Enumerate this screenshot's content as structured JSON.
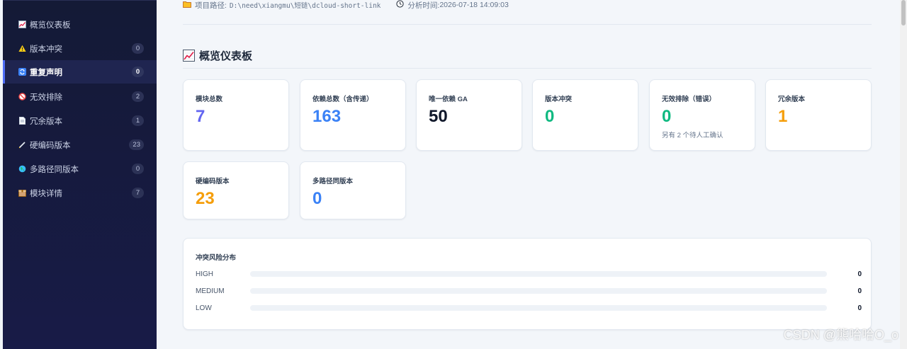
{
  "sidebar": {
    "items": [
      {
        "label": "概览仪表板",
        "badge": "",
        "icon": "chart-icon"
      },
      {
        "label": "版本冲突",
        "badge": "0",
        "icon": "warning-icon"
      },
      {
        "label": "重复声明",
        "badge": "0",
        "icon": "repeat-icon"
      },
      {
        "label": "无效排除",
        "badge": "2",
        "icon": "prohibited-icon"
      },
      {
        "label": "冗余版本",
        "badge": "1",
        "icon": "document-icon"
      },
      {
        "label": "硬编码版本",
        "badge": "23",
        "icon": "pencil-icon"
      },
      {
        "label": "多路径同版本",
        "badge": "0",
        "icon": "globe-icon"
      },
      {
        "label": "模块详情",
        "badge": "7",
        "icon": "package-icon"
      }
    ],
    "active_index": 2
  },
  "meta": {
    "path_label": "项目路径:",
    "path_value": "D:\\need\\xiangmu\\短链\\dcloud-short-link",
    "time_label": "分析时间:",
    "time_value": "2026-07-18 14:09:03"
  },
  "section": {
    "title": "概览仪表板"
  },
  "stats": [
    {
      "label": "模块总数",
      "value": "7",
      "color": "#6366f1",
      "sub": ""
    },
    {
      "label": "依赖总数（含传递）",
      "value": "163",
      "color": "#3b82f6",
      "sub": ""
    },
    {
      "label": "唯一依赖 GA",
      "value": "50",
      "color": "#0f172a",
      "sub": ""
    },
    {
      "label": "版本冲突",
      "value": "0",
      "color": "#10b981",
      "sub": ""
    },
    {
      "label": "无效排除（错误）",
      "value": "0",
      "color": "#10b981",
      "sub": "另有 2 个待人工确认"
    },
    {
      "label": "冗余版本",
      "value": "1",
      "color": "#f59e0b",
      "sub": ""
    },
    {
      "label": "硬编码版本",
      "value": "23",
      "color": "#f59e0b",
      "sub": ""
    },
    {
      "label": "多路径同版本",
      "value": "0",
      "color": "#3b82f6",
      "sub": ""
    }
  ],
  "risk": {
    "title": "冲突风险分布",
    "rows": [
      {
        "name": "HIGH",
        "count": "0",
        "fraction": 0,
        "color": "#ef4444"
      },
      {
        "name": "MEDIUM",
        "count": "0",
        "fraction": 0,
        "color": "#f59e0b"
      },
      {
        "name": "LOW",
        "count": "0",
        "fraction": 0,
        "color": "#3b82f6"
      }
    ]
  },
  "watermark": "CSDN @熊哈哈O_o"
}
